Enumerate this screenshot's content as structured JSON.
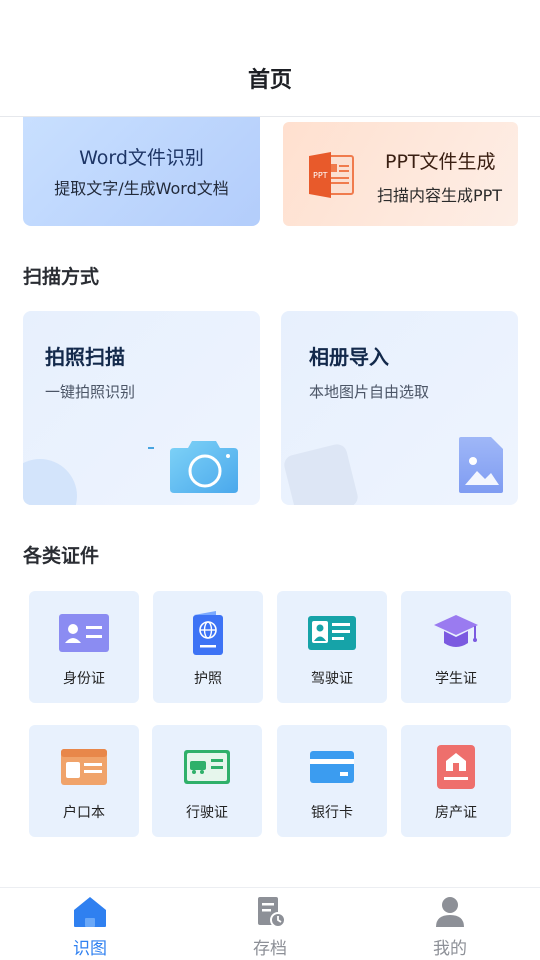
{
  "header": {
    "title": "首页"
  },
  "feature_cards": {
    "word": {
      "title": "Word文件识别",
      "subtitle": "提取文字/生成Word文档"
    },
    "ppt": {
      "title": "PPT文件生成",
      "subtitle": "扫描内容生成PPT",
      "icon": "ppt-file-icon",
      "icon_text": "PPT"
    }
  },
  "scan_section": {
    "title": "扫描方式",
    "items": [
      {
        "title": "拍照扫描",
        "subtitle": "一键拍照识别",
        "icon": "camera-icon"
      },
      {
        "title": "相册导入",
        "subtitle": "本地图片自由选取",
        "icon": "image-file-icon"
      }
    ]
  },
  "certs_section": {
    "title": "各类证件",
    "items": [
      {
        "label": "身份证",
        "icon": "id-card-icon"
      },
      {
        "label": "护照",
        "icon": "passport-icon"
      },
      {
        "label": "驾驶证",
        "icon": "driver-license-icon"
      },
      {
        "label": "学生证",
        "icon": "student-card-icon"
      },
      {
        "label": "户口本",
        "icon": "household-register-icon"
      },
      {
        "label": "行驶证",
        "icon": "vehicle-license-icon"
      },
      {
        "label": "银行卡",
        "icon": "bank-card-icon"
      },
      {
        "label": "房产证",
        "icon": "property-certificate-icon"
      }
    ]
  },
  "tabbar": {
    "active_color": "#2f80f0",
    "inactive_color": "#8d9097",
    "items": [
      {
        "label": "识图",
        "icon": "home-icon",
        "active": true
      },
      {
        "label": "存档",
        "icon": "archive-icon",
        "active": false
      },
      {
        "label": "我的",
        "icon": "user-icon",
        "active": false
      }
    ]
  }
}
